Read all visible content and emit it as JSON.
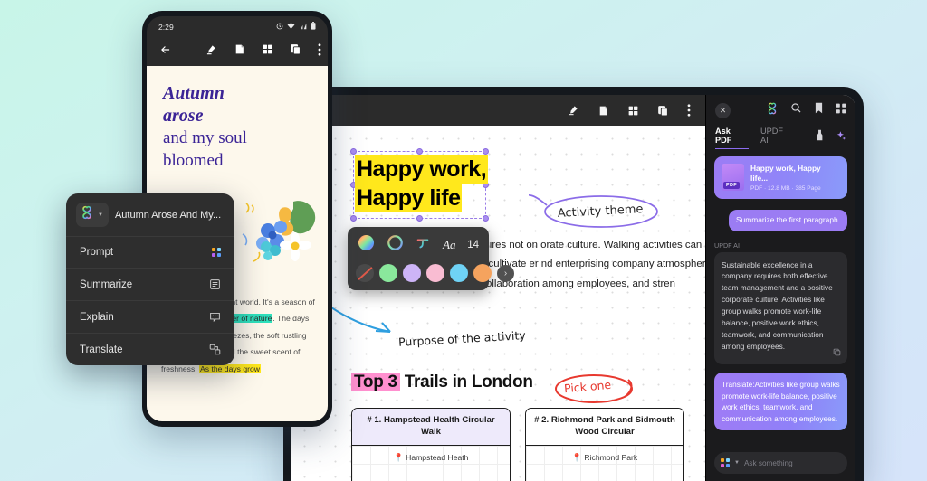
{
  "background": {
    "from": "#c8f5e8",
    "to": "#d6e4fa"
  },
  "phone": {
    "status": {
      "time": "2:29",
      "icons": [
        "alarm-icon",
        "wifi-icon",
        "signal-icon",
        "battery-icon"
      ]
    },
    "toolbar": {
      "back": "back-arrow-icon",
      "items": [
        "highlighter-icon",
        "sticky-note-icon",
        "grid-icon",
        "pages-icon",
        "more-vertical-icon"
      ]
    },
    "document": {
      "title_line1": "Autumn",
      "title_line2": "arose",
      "title_line3": "and my soul",
      "title_line4": "bloomed",
      "title_color": "#3b2496",
      "paragraph_pre": "s of autumn as vibrant world. It's a season of brings new energy ",
      "highlight_teal": "ner of nature",
      "paragraph_mid": ". The days abound with cool breezes, the soft rustling of golden leaves, and the sweet scent of freshness. ",
      "highlight_yellow": "As the days grow",
      "highlight_teal_color": "#2ee0bc",
      "highlight_yellow_color": "#ffe81c"
    }
  },
  "ai_menu": {
    "logo": "ai-clover-logo-icon",
    "title": "Autumn Arose And My...",
    "items": [
      {
        "label": "Prompt",
        "icon": "four-dots-icon"
      },
      {
        "label": "Summarize",
        "icon": "list-lines-icon"
      },
      {
        "label": "Explain",
        "icon": "chat-bubble-icon"
      },
      {
        "label": "Translate",
        "icon": "translate-blocks-icon"
      }
    ]
  },
  "tablet": {
    "toolbar": {
      "items": [
        "highlighter-icon",
        "sticky-note-icon",
        "grid-icon",
        "pages-icon",
        "more-vertical-icon"
      ]
    },
    "document": {
      "heading_line1": "Happy work,",
      "heading_line2": "Happy life",
      "heading_highlight": "#ffe81c",
      "body": "of an excellent company requires not on orate culture. Walking activities can not work and happy life, but also cultivate er nd enterprising company atmosphere. At mutual communication and collaboration among employees, and stren",
      "annotation_activity": "Activity theme",
      "annotation_purpose": "Purpose of the activity",
      "annotation_pick": "Pick one",
      "trails_highlight": "Top 3",
      "trails_rest": " Trails in London",
      "trails_highlight_color": "#ff90cf",
      "cards": [
        {
          "title": "# 1. Hampstead Health Circular Walk",
          "place": "Hampstead Heath"
        },
        {
          "title": "# 2. Richmond Park and Sidmouth Wood Circular",
          "place": "Richmond Park"
        }
      ]
    },
    "format_toolbar": {
      "icons": [
        "color-wheel-icon",
        "outline-circle-icon",
        "text-style-icon"
      ],
      "font_label": "Aa",
      "font_size": "14",
      "swatches": [
        "none",
        "#8ae89c",
        "#cdb4f7",
        "#f9bcd2",
        "#6fd2f5",
        "#f5a35e"
      ],
      "next_icon": "chevron-right-icon"
    },
    "ai_panel": {
      "close_icon": "close-icon",
      "top_icons": [
        "ai-clover-logo-icon",
        "search-icon",
        "bookmark-icon",
        "grid-icon"
      ],
      "tabs": [
        {
          "label": "Ask PDF",
          "active": true
        },
        {
          "label": "UPDF AI",
          "active": false
        }
      ],
      "tab_icons": [
        "pen-tool-icon",
        "sparkle-icon"
      ],
      "pdf_card": {
        "name": "Happy work, Happy life...",
        "meta": "PDF · 12.8 MB · 385 Page",
        "badge": "PDF"
      },
      "user_message": "Summarize the first paragraph.",
      "assistant_label": "UPDF AI",
      "assistant_message": "Sustainable excellence in a company requires both effective team management and a positive corporate culture. Activities like group walks promote work-life balance, positive work ethics, teamwork, and communication among employees.",
      "copy_icon": "copy-icon",
      "translate_message": "Translate:Activities like group walks promote work-life balance, positive work ethics, teamwork, and communication among employees.",
      "input_placeholder": "Ask something",
      "input_icon": "four-dots-icon",
      "input_caret": "chevron-down-icon"
    }
  }
}
